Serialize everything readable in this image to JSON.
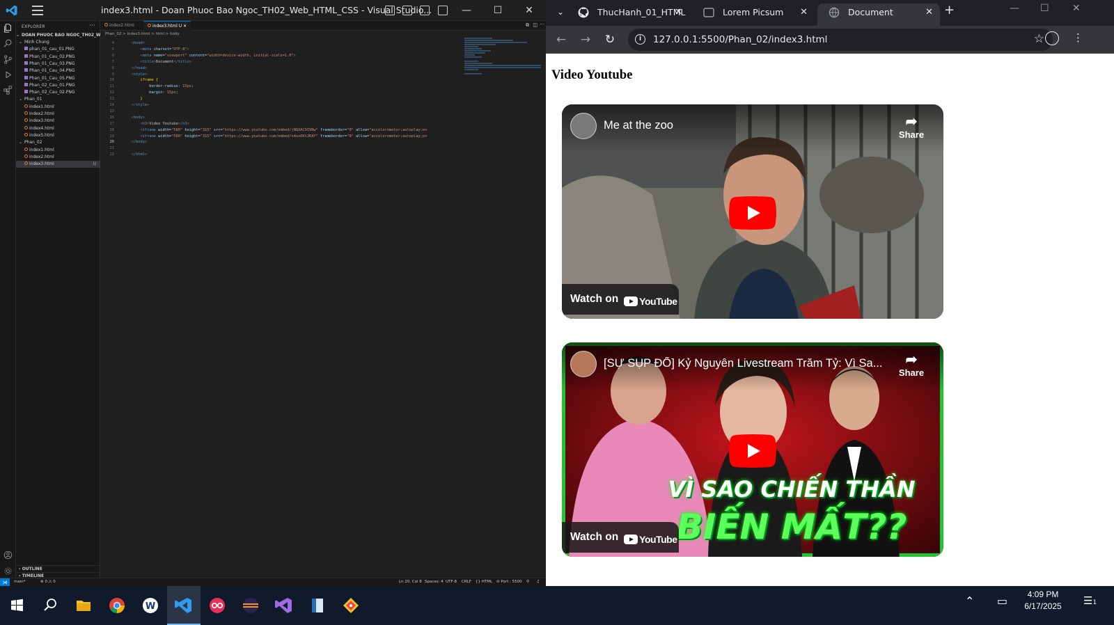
{
  "vscode": {
    "window_title": "index3.html - Doan Phuoc Bao Ngoc_TH02_Web_HTML_CSS - Visual Studio...",
    "explorer": {
      "header": "EXPLORER",
      "root": "DOAN PHUOC BAO NGOC_TH02_WEB_HT...",
      "items": [
        {
          "label": "Minh Chung",
          "kind": "folder",
          "depth": 1
        },
        {
          "label": "phan_01_cau_01.PNG",
          "kind": "png",
          "depth": 2
        },
        {
          "label": "Phan_01_Cau_02.PNG",
          "kind": "png",
          "depth": 2
        },
        {
          "label": "Phan_01_Cau_03.PNG",
          "kind": "png",
          "depth": 2
        },
        {
          "label": "Phan_01_Cau_04.PNG",
          "kind": "png",
          "depth": 2
        },
        {
          "label": "Phan_01_Cau_05.PNG",
          "kind": "png",
          "depth": 2
        },
        {
          "label": "Phan_02_Cau_01.PNG",
          "kind": "png",
          "depth": 2
        },
        {
          "label": "Phan_02_Cau_02.PNG",
          "kind": "png",
          "depth": 2
        },
        {
          "label": "Phan_01",
          "kind": "folder",
          "depth": 1
        },
        {
          "label": "index1.html",
          "kind": "html",
          "depth": 2
        },
        {
          "label": "index2.html",
          "kind": "html",
          "depth": 2
        },
        {
          "label": "index3.html",
          "kind": "html",
          "depth": 2
        },
        {
          "label": "index4.html",
          "kind": "html",
          "depth": 2
        },
        {
          "label": "index5.html",
          "kind": "html",
          "depth": 2
        },
        {
          "label": "Phan_02",
          "kind": "folder",
          "depth": 1
        },
        {
          "label": "index1.html",
          "kind": "html",
          "depth": 2
        },
        {
          "label": "index2.html",
          "kind": "html",
          "depth": 2
        },
        {
          "label": "index3.html",
          "kind": "html",
          "depth": 2
        }
      ],
      "outline": "OUTLINE",
      "timeline": "TIMELINE"
    },
    "tabs": [
      {
        "label": "index2.html"
      },
      {
        "label": "index3.html U"
      }
    ],
    "breadcrumb": "Phan_02 > index3.html > html > body",
    "code_lines": [
      {
        "n": "4",
        "html": "    <span class='pu'>&lt;</span><span class='tg'>head</span><span class='pu'>&gt;</span>"
      },
      {
        "n": "5",
        "html": "        <span class='pu'>&lt;</span><span class='tg'>meta</span> <span class='at'>charset</span>=<span class='st'>\"UTF-8\"</span><span class='pu'>&gt;</span>"
      },
      {
        "n": "6",
        "html": "        <span class='pu'>&lt;</span><span class='tg'>meta</span> <span class='at'>name</span>=<span class='st'>\"viewport\"</span> <span class='at'>content</span>=<span class='st'>\"width=device-width, initial-scale=1.0\"</span><span class='pu'>&gt;</span>"
      },
      {
        "n": "7",
        "html": "        <span class='pu'>&lt;</span><span class='tg'>title</span><span class='pu'>&gt;</span><span class='tx'>Document</span><span class='pu'>&lt;/</span><span class='tg'>title</span><span class='pu'>&gt;</span>"
      },
      {
        "n": "8",
        "html": "    <span class='pu'>&lt;/</span><span class='tg'>head</span><span class='pu'>&gt;</span>"
      },
      {
        "n": "9",
        "html": "    <span class='pu'>&lt;</span><span class='tg'>style</span><span class='pu'>&gt;</span>"
      },
      {
        "n": "10",
        "html": "        <span class='br'>iframe</span> <span class='br'>{</span>"
      },
      {
        "n": "11",
        "html": "            <span class='at'>border-radius</span><span class='tx'>: </span><span class='st'>15px</span><span class='tx'>;</span>"
      },
      {
        "n": "12",
        "html": "            <span class='at'>margin</span><span class='tx'>: </span><span class='st'>15px</span><span class='tx'>;</span>"
      },
      {
        "n": "13",
        "html": "        <span class='br'>}</span>"
      },
      {
        "n": "14",
        "html": "    <span class='pu'>&lt;/</span><span class='tg'>style</span><span class='pu'>&gt;</span>"
      },
      {
        "n": "15",
        "html": ""
      },
      {
        "n": "16",
        "html": "    <span class='pu'>&lt;</span><span class='tg'>body</span><span class='pu'>&gt;</span>"
      },
      {
        "n": "17",
        "html": "        <span class='pu'>&lt;</span><span class='tg'>h3</span><span class='pu'>&gt;</span><span class='tx'>Video Youtube</span><span class='pu'>&lt;/</span><span class='tg'>h3</span><span class='pu'>&gt;</span>"
      },
      {
        "n": "18",
        "html": "        <span class='pu'>&lt;</span><span class='tg'>iframe</span> <span class='at'>width</span>=<span class='st'>\"560\"</span> <span class='at'>height</span>=<span class='st'>\"315\"</span> <span class='at'>src</span>=<span class='st'>\"https://www.youtube.com/embed/jNQXAC9IVRw\"</span> <span class='at'>frameborder</span>=<span class='st'>\"0\"</span> <span class='at'>allow</span>=<span class='st'>\"accelerometer;autoplay;en</span>"
      },
      {
        "n": "19",
        "html": "        <span class='pu'>&lt;</span><span class='tg'>iframe</span> <span class='at'>width</span>=<span class='st'>\"560\"</span> <span class='at'>height</span>=<span class='st'>\"315\"</span> <span class='at'>src</span>=<span class='st'>\"https://www.youtube.com/embed/n4uvOKtJEAY\"</span> <span class='at'>frameborder</span>=<span class='st'>\"0\"</span> <span class='at'>allow</span>=<span class='st'>\"accelerometer;autoplay;en</span>"
      },
      {
        "n": "20",
        "html": "    <span class='pu'>&lt;/</span><span class='tg'>body</span><span class='pu'>&gt;</span>"
      },
      {
        "n": "21",
        "html": ""
      },
      {
        "n": "22",
        "html": "    <span class='pu'>&lt;/</span><span class='tg'>html</span><span class='pu'>&gt;</span>"
      }
    ],
    "status": {
      "branch": "main*",
      "problems": "⊗ 0 ⚠ 0",
      "position": "Ln 20, Col 8",
      "spaces": "Spaces: 4",
      "encoding": "UTF-8",
      "eol": "CRLF",
      "language": "{} HTML",
      "port": "⊘ Port : 5500"
    }
  },
  "chrome": {
    "tabs": [
      {
        "label": "ThucHanh_01_HTML"
      },
      {
        "label": "Lorem Picsum"
      },
      {
        "label": "Document"
      }
    ],
    "url": "127.0.0.1:5500/Phan_02/index3.html",
    "page": {
      "heading": "Video Youtube",
      "videos": [
        {
          "title": "Me at the zoo",
          "share": "Share",
          "watch_on": "Watch on",
          "brand": "YouTube"
        },
        {
          "title": "[SỰ SỤP ĐỔ] Kỷ Nguyên Livestream Trăm Tỷ: Vì Sa...",
          "share": "Share",
          "watch_on": "Watch on",
          "brand": "YouTube",
          "overlay_line1": "VÌ SAO CHIẾN THẦN",
          "overlay_line2": "BIẾN MẤT??"
        }
      ]
    }
  },
  "taskbar": {
    "time": "4:09 PM",
    "date": "6/17/2025",
    "notifications": "1"
  },
  "colors": {
    "vscode_bg": "#1f1f1f",
    "accent": "#0078d4",
    "youtube_red": "#ff0000",
    "taskbar_bg": "#101a2a"
  }
}
